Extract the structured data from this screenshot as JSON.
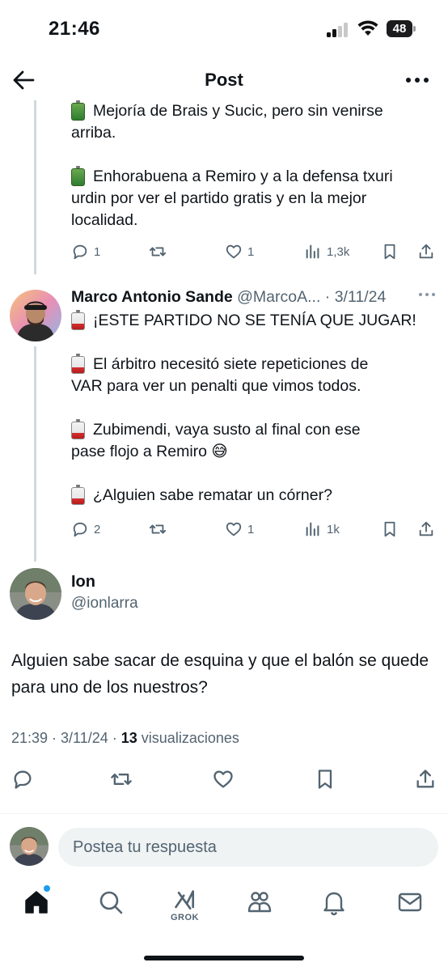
{
  "status_bar": {
    "time": "21:46",
    "battery": "48"
  },
  "header": {
    "title": "Post",
    "back_icon": "arrow-left-icon",
    "more_icon": "more-horizontal-icon"
  },
  "prev_tweet": {
    "lines": [
      {
        "emoji": "battery-full",
        "text": "Mejoría de Brais y Sucic, pero sin venirse"
      },
      {
        "emoji": "",
        "text": "arriba."
      },
      {
        "emoji": "",
        "text": ""
      },
      {
        "emoji": "battery-full",
        "text": "Enhorabuena a Remiro y a la defensa txuri"
      },
      {
        "emoji": "",
        "text": "urdin por ver el partido gratis y en la mejor"
      },
      {
        "emoji": "",
        "text": "localidad."
      }
    ],
    "stats": {
      "replies": "1",
      "likes": "1",
      "views": "1,3k"
    }
  },
  "reply_tweet": {
    "name": "Marco Antonio Sande",
    "handle": "@MarcoA...",
    "date": "· 3/11/24",
    "lines": [
      {
        "emoji": "battery-low",
        "text": "¡ESTE PARTIDO NO SE TENÍA QUE JUGAR!"
      },
      {
        "emoji": "",
        "text": ""
      },
      {
        "emoji": "battery-low",
        "text": "El árbitro necesitó siete repeticiones de"
      },
      {
        "emoji": "",
        "text": "VAR para ver un penalti que vimos todos."
      },
      {
        "emoji": "",
        "text": ""
      },
      {
        "emoji": "battery-low",
        "text": "Zubimendi, vaya susto al final con ese"
      },
      {
        "emoji": "",
        "text": "pase flojo a Remiro 😅"
      },
      {
        "emoji": "",
        "text": ""
      },
      {
        "emoji": "battery-low",
        "text": "¿Alguien sabe rematar un córner?"
      }
    ],
    "stats": {
      "replies": "2",
      "likes": "1",
      "views": "1k"
    }
  },
  "main_tweet": {
    "name": "Ion",
    "handle": "@ionlarra",
    "text": "Alguien sabe sacar de esquina y que el balón se quede para uno de los nuestros?",
    "time": "21:39 · 3/11/24 · ",
    "views": "13",
    "views_label": " visualizaciones"
  },
  "composer": {
    "placeholder": "Postea tu respuesta"
  },
  "bottom_nav": {
    "grok_label": "GROK"
  },
  "colors": {
    "text": "#0f1419",
    "muted": "#536471",
    "accent": "#1d9bf0",
    "thread": "#cfd9de"
  }
}
